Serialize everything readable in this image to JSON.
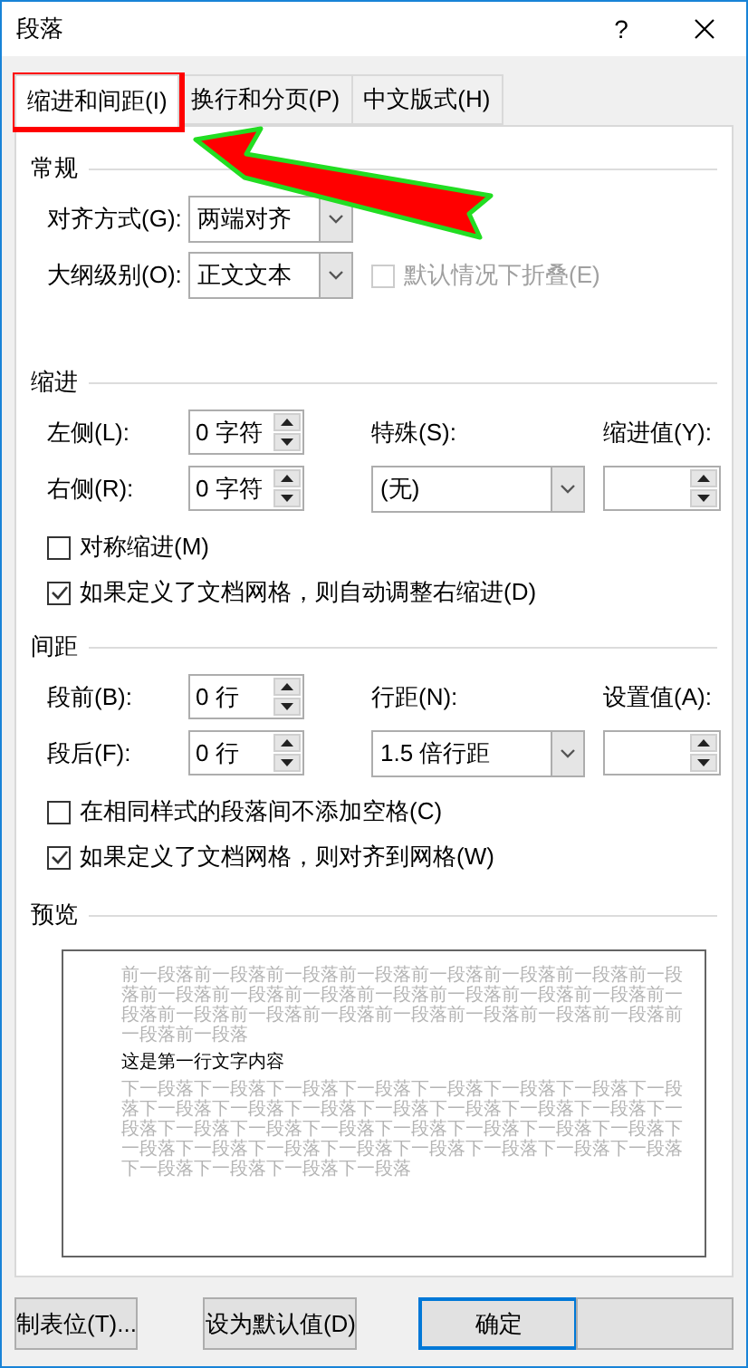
{
  "window": {
    "title": "段落",
    "help": "?"
  },
  "tabs": [
    {
      "label": "缩进和间距(I)",
      "selected": true
    },
    {
      "label": "换行和分页(P)",
      "selected": false
    },
    {
      "label": "中文版式(H)",
      "selected": false
    }
  ],
  "general": {
    "heading": "常规",
    "fields": [
      {
        "label": "对齐方式(G):",
        "value": "两端对齐"
      },
      {
        "label": "大纲级别(O):",
        "value": "正文文本"
      }
    ],
    "collapse": {
      "label": "默认情况下折叠(E)",
      "checked": false,
      "disabled": true
    }
  },
  "indent": {
    "heading": "缩进",
    "spinners": [
      {
        "label": "左侧(L):",
        "value": "0 字符"
      },
      {
        "label": "右侧(R):",
        "value": "0 字符"
      }
    ],
    "special": {
      "label": "特殊(S):",
      "value": "(无)"
    },
    "amount": {
      "label": "缩进值(Y):"
    },
    "options": [
      {
        "label": "对称缩进(M)",
        "checked": false
      },
      {
        "label": "如果定义了文档网格，则自动调整右缩进(D)",
        "checked": true
      }
    ]
  },
  "spacing": {
    "heading": "间距",
    "spinners": [
      {
        "label": "段前(B):",
        "value": "0 行"
      },
      {
        "label": "段后(F):",
        "value": "0 行"
      }
    ],
    "special": {
      "label": "行距(N):",
      "value": "1.5 倍行距"
    },
    "amount": {
      "label": "设置值(A):"
    },
    "options": [
      {
        "label": "在相同样式的段落间不添加空格(C)",
        "checked": false
      },
      {
        "label": "如果定义了文档网格，则对齐到网格(W)",
        "checked": true
      }
    ]
  },
  "preview": {
    "heading": "预览",
    "previous": "前一段落前一段落前一段落前一段落前一段落前一段落前一段落前一段落前一段落前一段落前一段落前一段落前一段落前一段落前一段落前一段落前一段落前一段落前一段落前一段落前一段落前一段落前一段落前一段落前一段落",
    "current": "这是第一行文字内容",
    "next": "下一段落下一段落下一段落下一段落下一段落下一段落下一段落下一段落下一段落下一段落下一段落下一段落下一段落下一段落下一段落下一段落下一段落下一段落下一段落下一段落下一段落下一段落下一段落下一段落下一段落下一段落下一段落下一段落下一段落下一段落下一段落下一段落下一段落下一段落下一段落"
  },
  "buttons": [
    {
      "kind": "normal",
      "label": "制表位(T)..."
    },
    {
      "kind": "normal",
      "label": "设为默认值(D)"
    },
    {
      "kind": "default",
      "label": "确定"
    },
    {
      "kind": "covered"
    }
  ],
  "annotations": {
    "highlight_box": true,
    "arrow": true
  }
}
